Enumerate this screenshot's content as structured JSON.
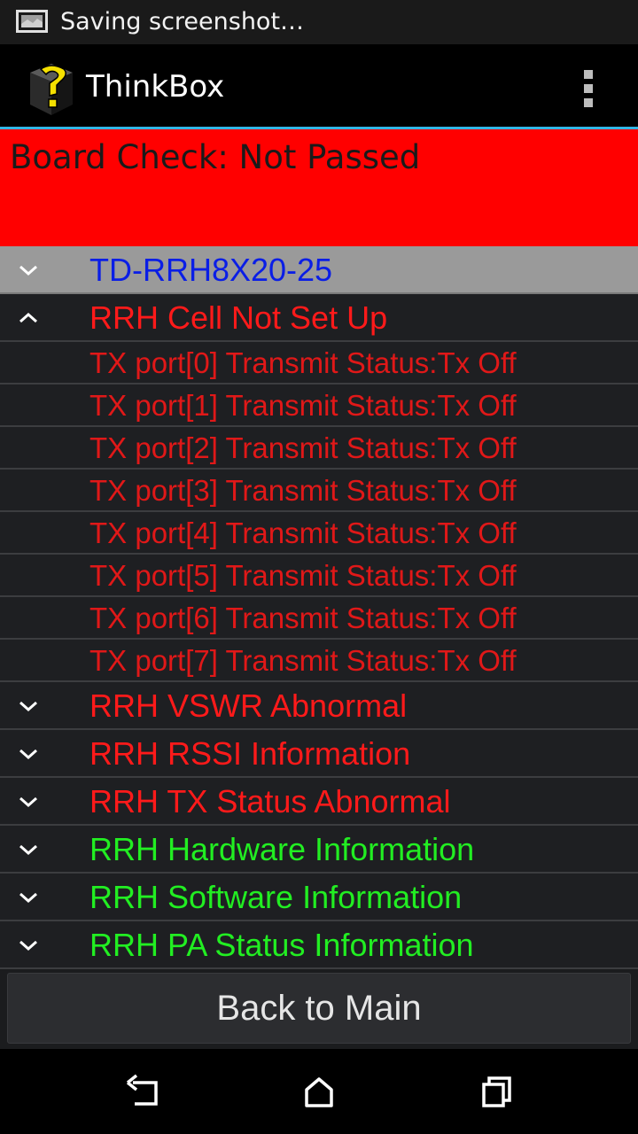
{
  "status_bar": {
    "text": "Saving screenshot…",
    "icon": "screenshot-icon"
  },
  "action_bar": {
    "title": "ThinkBox",
    "logo": "thinkbox-logo-icon",
    "overflow_icon": "overflow-menu-icon"
  },
  "banner": {
    "text": "Board Check: Not Passed",
    "color": "#ff0000"
  },
  "device_header": {
    "label": "TD-RRH8X20-25",
    "color": "#0a1ee6",
    "expanded": false
  },
  "groups": [
    {
      "label": "RRH Cell Not Set Up",
      "color": "#ff1a1a",
      "expanded": true,
      "children": [
        "TX port[0] Transmit Status:Tx Off",
        "TX port[1] Transmit Status:Tx Off",
        "TX port[2] Transmit Status:Tx Off",
        "TX port[3] Transmit Status:Tx Off",
        "TX port[4] Transmit Status:Tx Off",
        "TX port[5] Transmit Status:Tx Off",
        "TX port[6] Transmit Status:Tx Off",
        "TX port[7] Transmit Status:Tx Off"
      ]
    },
    {
      "label": "RRH VSWR Abnormal",
      "color": "#ff1a1a",
      "expanded": false
    },
    {
      "label": "RRH RSSI Information",
      "color": "#ff1a1a",
      "expanded": false
    },
    {
      "label": "RRH TX Status Abnormal",
      "color": "#ff1a1a",
      "expanded": false
    },
    {
      "label": "RRH Hardware Information",
      "color": "#22ee22",
      "expanded": false
    },
    {
      "label": "RRH Software Information",
      "color": "#22ee22",
      "expanded": false
    },
    {
      "label": "RRH PA Status Information",
      "color": "#22ee22",
      "expanded": false
    }
  ],
  "child_color": "#e01818",
  "back_button": {
    "label": "Back to Main"
  },
  "nav_bar": {
    "back_icon": "back-icon",
    "home_icon": "home-icon",
    "recents_icon": "recents-icon"
  }
}
